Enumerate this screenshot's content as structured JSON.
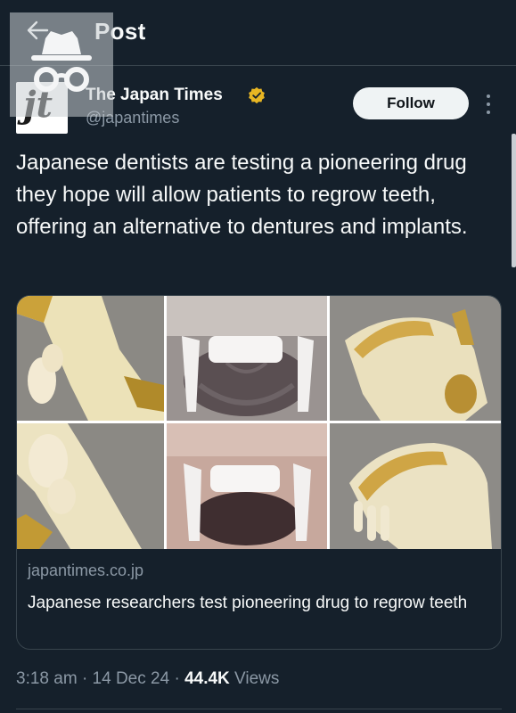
{
  "header": {
    "title": "Post"
  },
  "author": {
    "name": "The Japan Times",
    "handle": "@japantimes",
    "avatar_letters": "jt",
    "verified": true,
    "verified_color": "#e8b623"
  },
  "follow_label": "Follow",
  "post": {
    "text": "Japanese dentists are testing a pioneering drug they hope will allow patients to regrow teeth, offering an alternative to dentures and implants."
  },
  "link_card": {
    "domain": "japantimes.co.jp",
    "title": "Japanese researchers test pioneering drug to regrow teeth",
    "images": [
      "jaw-specimen-top-left",
      "mouse-teeth-top-center",
      "jaw-specimen-top-right",
      "jaw-specimen-bottom-left",
      "mouse-teeth-bottom-center",
      "jaw-specimen-bottom-right"
    ]
  },
  "meta": {
    "time": "3:18 am",
    "separator": "·",
    "date": "14 Dec 24",
    "views_count": "44.4K",
    "views_label": "Views"
  },
  "colors": {
    "background": "#15202b",
    "text": "#f7f9f9",
    "muted": "#8b98a5",
    "border": "#38444d"
  }
}
